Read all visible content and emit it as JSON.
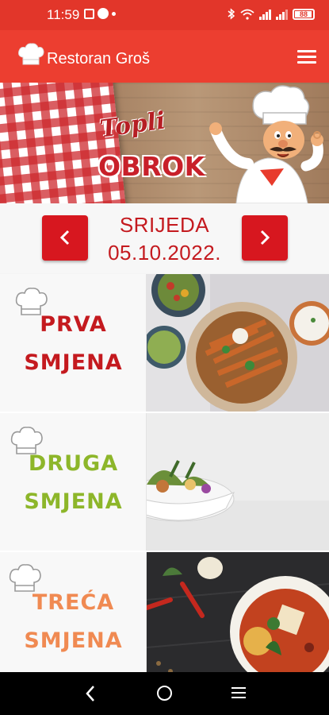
{
  "status_bar": {
    "time": "11:59",
    "battery": "88"
  },
  "app_bar": {
    "title": "Restoran Groš"
  },
  "banner": {
    "line1": "Topli",
    "line2": "OBROK"
  },
  "day": {
    "name": "SRIJEDA",
    "date": "05.10.2022.",
    "prev_label": "‹",
    "next_label": "›"
  },
  "shifts": [
    {
      "line1": "PRVA",
      "line2": "SMJENA",
      "color": "#c41a1f"
    },
    {
      "line1": "DRUGA",
      "line2": "SMJENA",
      "color": "#8db62a"
    },
    {
      "line1": "TREĆA",
      "line2": "SMJENA",
      "color": "#f08a52"
    }
  ],
  "colors": {
    "primary": "#ec3e30",
    "accent": "#d7171f"
  }
}
